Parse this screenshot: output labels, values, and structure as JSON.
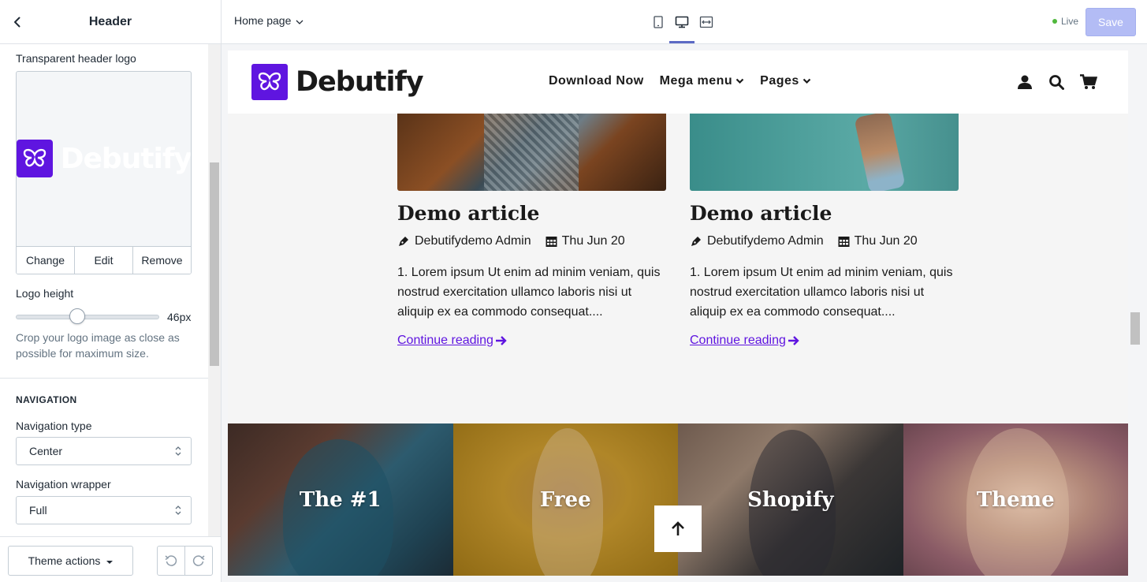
{
  "sidebar": {
    "title": "Header",
    "logo_label": "Transparent header logo",
    "logo_word": "Debutify",
    "logo_actions": [
      "Change",
      "Edit",
      "Remove"
    ],
    "logo_height_label": "Logo height",
    "logo_height_value": "46px",
    "logo_height_fraction": 0.41,
    "help_text": "Crop your logo image as close as possible for maximum size.",
    "navigation_heading": "NAVIGATION",
    "navigation_type_label": "Navigation type",
    "navigation_type_value": "Center",
    "navigation_wrapper_label": "Navigation wrapper",
    "navigation_wrapper_value": "Full",
    "theme_actions_label": "Theme actions"
  },
  "topbar": {
    "page": "Home page",
    "device_selected": "desktop",
    "live_label": "Live",
    "save_label": "Save"
  },
  "preview": {
    "brand": "Debutify",
    "nav": [
      "Download Now",
      "Mega menu",
      "Pages"
    ],
    "articles": [
      {
        "title": "Demo article",
        "author": "Debutifydemo Admin",
        "date": "Thu Jun 20",
        "excerpt": "1. Lorem ipsum Ut enim ad minim veniam, quis nostrud exercitation ullamco laboris nisi ut aliquip ex ea commodo consequat....",
        "link": "Continue reading "
      },
      {
        "title": "Demo article",
        "author": "Debutifydemo Admin",
        "date": "Thu Jun 20",
        "excerpt": "1. Lorem ipsum Ut enim ad minim veniam, quis nostrud exercitation ullamco laboris nisi ut aliquip ex ea commodo consequat....",
        "link": "Continue reading "
      }
    ],
    "banner_tiles": [
      "The #1",
      "Free",
      "Shopify",
      "Theme"
    ]
  },
  "colors": {
    "brand_purple": "#5f15e0",
    "save_disabled": "#b3bcf5",
    "live_dot": "#50b83c",
    "device_active": "#5c6ac4"
  }
}
